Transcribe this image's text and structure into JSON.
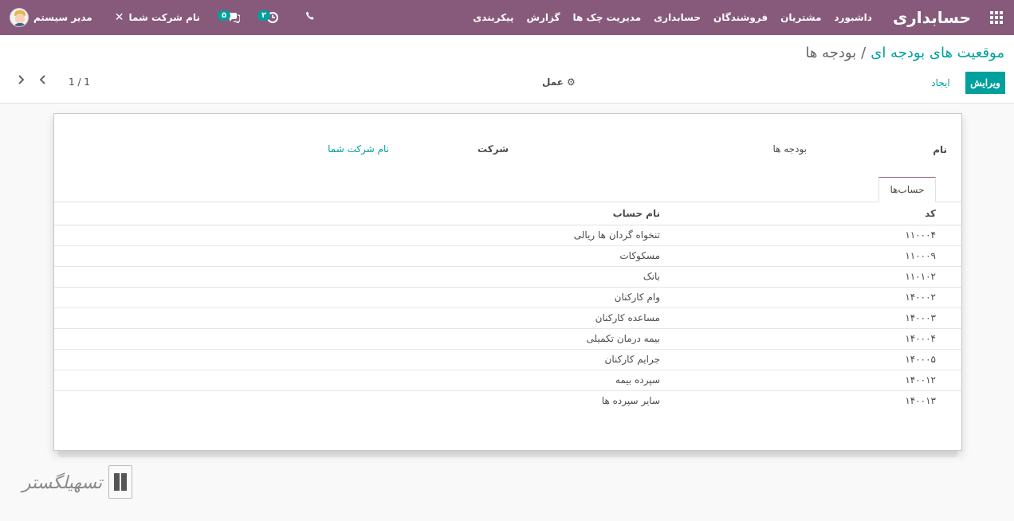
{
  "navbar": {
    "brand": "حسابداری",
    "menu": [
      "داشبورد",
      "مشتریان",
      "فروشندگان",
      "حسابداری",
      "مدیریت چک ها",
      "گزارش",
      "پیکربندی"
    ],
    "user_name": "مدیر سیستم",
    "company_name": "نام شرکت شما",
    "messages_badge": "۵",
    "activities_badge": "۲",
    "icons": [
      "apps-icon",
      "phone-icon",
      "clock-icon",
      "chat-icon",
      "tools-icon"
    ]
  },
  "control_panel": {
    "breadcrumb_parent": "موقعیت های بودجه ای",
    "breadcrumb_sep": "/",
    "breadcrumb_current": "بودجه ها",
    "edit_label": "ویرایش",
    "create_label": "ایجاد",
    "action_label": "عمل",
    "pager_value": "1 / 1"
  },
  "form": {
    "name_label": "نام",
    "name_value": "بودجه ها",
    "company_label": "شرکت",
    "company_value": "نام شرکت شما",
    "tab_label": "حساب‌ها",
    "columns": {
      "code": "کد",
      "account_name": "نام حساب"
    },
    "rows": [
      {
        "code": "۱۱۰۰۰۴",
        "name": "تنخواه گردان ها ریالی"
      },
      {
        "code": "۱۱۰۰۰۹",
        "name": "مسکوکات"
      },
      {
        "code": "۱۱۰۱۰۲",
        "name": "بانک"
      },
      {
        "code": "۱۴۰۰۰۲",
        "name": "وام کارکنان"
      },
      {
        "code": "۱۴۰۰۰۳",
        "name": "مساعده کارکنان"
      },
      {
        "code": "۱۴۰۰۰۴",
        "name": "بیمه درمان تکمیلی"
      },
      {
        "code": "۱۴۰۰۰۵",
        "name": "جرایم کارکنان"
      },
      {
        "code": "۱۴۰۰۱۲",
        "name": "سپرده بیمه"
      },
      {
        "code": "۱۴۰۰۱۳",
        "name": "سایر سپرده ها"
      }
    ]
  },
  "watermark": {
    "text": "تسهیلگستر"
  },
  "colors": {
    "navbar": "#875a7b",
    "accent": "#00a09d"
  }
}
